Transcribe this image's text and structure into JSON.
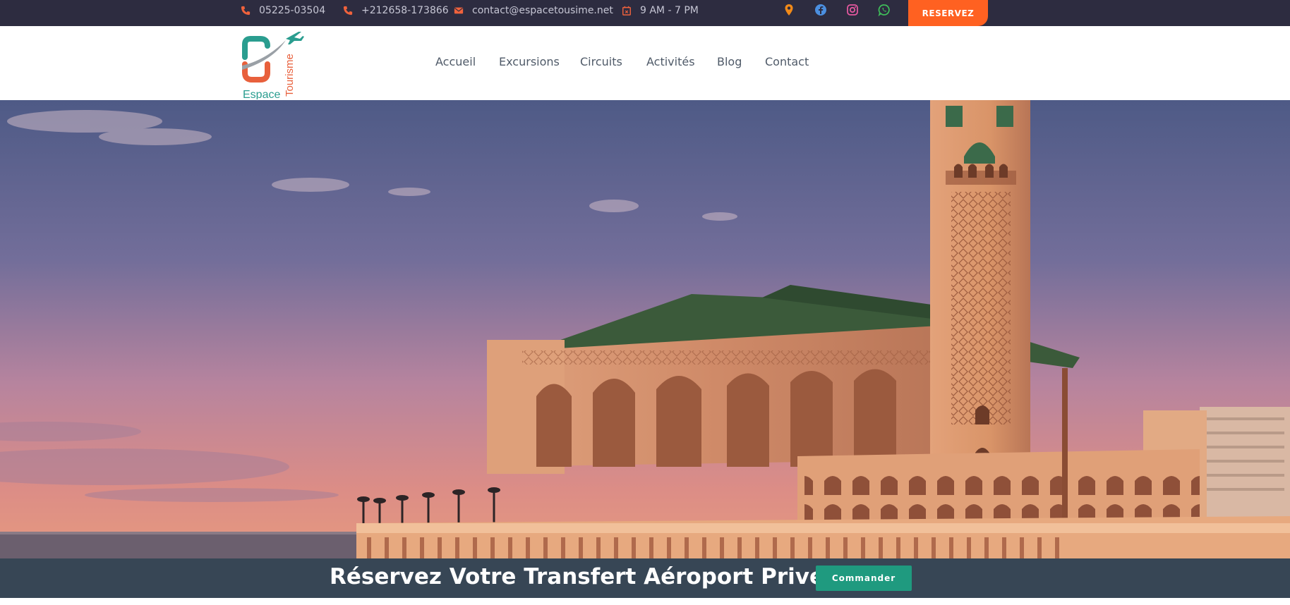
{
  "topbar": {
    "phone1": "05225-03504",
    "phone2": "+212658-173866",
    "email": "contact@espacetousime.net",
    "hours": "9 AM - 7 PM",
    "reserve_label": "RESERVEZ",
    "icons": [
      "phone-icon",
      "phone-icon",
      "email-icon",
      "calendar-icon",
      "map-pin-icon",
      "facebook-icon",
      "instagram-icon",
      "whatsapp-icon"
    ]
  },
  "header": {
    "logo_text_1": "Espace",
    "logo_text_2": "Tourisme",
    "nav": {
      "home": "Accueil",
      "excursions": "Excursions",
      "circuits": "Circuits",
      "activities": "Activités",
      "blog": "Blog",
      "contact": "Contact"
    }
  },
  "banner": {
    "title": "Réservez Votre Transfert Aéroport Privé",
    "button_label": "Commander"
  },
  "colors": {
    "topbar_bg": "#2d2c40",
    "accent_orange": "#ff6121",
    "banner_bg": "#374655",
    "button_green": "#1f9a7f"
  }
}
